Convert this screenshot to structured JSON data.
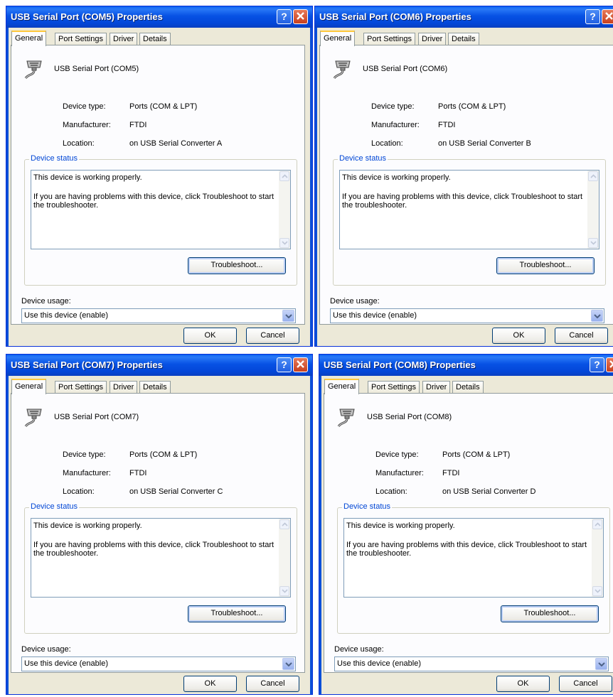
{
  "dialogs": [
    {
      "title": "USB Serial Port (COM5) Properties",
      "tabs": [
        "General",
        "Port Settings",
        "Driver",
        "Details"
      ],
      "device_name": "USB Serial Port (COM5)",
      "props": [
        {
          "label": "Device type:",
          "value": "Ports (COM & LPT)"
        },
        {
          "label": "Manufacturer:",
          "value": "FTDI"
        },
        {
          "label": "Location:",
          "value": "on USB Serial Converter A"
        }
      ],
      "status_legend": "Device status",
      "status_line1": "This device is working properly.",
      "status_line2": "If you are having problems with this device, click Troubleshoot to start the troubleshooter.",
      "troubleshoot": "Troubleshoot...",
      "usage_label": "Device usage:",
      "usage_value": "Use this device (enable)",
      "ok": "OK",
      "cancel": "Cancel"
    },
    {
      "title": "USB Serial Port (COM6) Properties",
      "tabs": [
        "General",
        "Port Settings",
        "Driver",
        "Details"
      ],
      "device_name": "USB Serial Port (COM6)",
      "props": [
        {
          "label": "Device type:",
          "value": "Ports (COM & LPT)"
        },
        {
          "label": "Manufacturer:",
          "value": "FTDI"
        },
        {
          "label": "Location:",
          "value": "on USB Serial Converter B"
        }
      ],
      "status_legend": "Device status",
      "status_line1": "This device is working properly.",
      "status_line2": "If you are having problems with this device, click Troubleshoot to start the troubleshooter.",
      "troubleshoot": "Troubleshoot...",
      "usage_label": "Device usage:",
      "usage_value": "Use this device (enable)",
      "ok": "OK",
      "cancel": "Cancel"
    },
    {
      "title": "USB Serial Port (COM7) Properties",
      "tabs": [
        "General",
        "Port Settings",
        "Driver",
        "Details"
      ],
      "device_name": "USB Serial Port (COM7)",
      "props": [
        {
          "label": "Device type:",
          "value": "Ports (COM & LPT)"
        },
        {
          "label": "Manufacturer:",
          "value": "FTDI"
        },
        {
          "label": "Location:",
          "value": "on USB Serial Converter C"
        }
      ],
      "status_legend": "Device status",
      "status_line1": "This device is working properly.",
      "status_line2": "If you are having problems with this device, click Troubleshoot to start the troubleshooter.",
      "troubleshoot": "Troubleshoot...",
      "usage_label": "Device usage:",
      "usage_value": "Use this device (enable)",
      "ok": "OK",
      "cancel": "Cancel"
    },
    {
      "title": "USB Serial Port (COM8) Properties",
      "tabs": [
        "General",
        "Port Settings",
        "Driver",
        "Details"
      ],
      "device_name": "USB Serial Port (COM8)",
      "props": [
        {
          "label": "Device type:",
          "value": "Ports (COM & LPT)"
        },
        {
          "label": "Manufacturer:",
          "value": "FTDI"
        },
        {
          "label": "Location:",
          "value": "on USB Serial Converter D"
        }
      ],
      "status_legend": "Device status",
      "status_line1": "This device is working properly.",
      "status_line2": "If you are having problems with this device, click Troubleshoot to start the troubleshooter.",
      "troubleshoot": "Troubleshoot...",
      "usage_label": "Device usage:",
      "usage_value": "Use this device (enable)",
      "ok": "OK",
      "cancel": "Cancel"
    }
  ],
  "icons": {
    "help": "question-mark-icon",
    "close": "close-x-icon",
    "device": "serial-port-cable-icon",
    "scroll_up": "scroll-up-arrow-icon",
    "scroll_down": "scroll-down-arrow-icon",
    "dropdown": "chevron-down-icon"
  },
  "colors": {
    "titlebar": "#0752e2",
    "dialog_bg": "#ece9d8",
    "active_tab_highlight": "#ffc83c",
    "groupbox_legend": "#0046d5",
    "close_button": "#d9532f"
  }
}
